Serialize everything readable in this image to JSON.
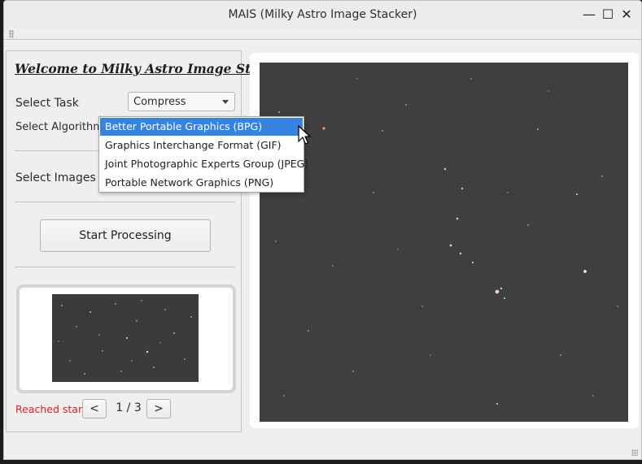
{
  "window": {
    "title": "MAIS (Milky Astro Image Stacker)",
    "minimize_glyph": "—",
    "maximize_glyph": "☐",
    "close_glyph": "✕"
  },
  "panel": {
    "welcome": "Welcome to Milky Astro Image Stacker",
    "task_label": "Select Task",
    "task_value": "Compress",
    "algorithm_label": "Select Algorithm",
    "images_label": "Select Images",
    "start_button": "Start Processing"
  },
  "algorithm_options": [
    "Better Portable Graphics (BPG)",
    "Graphics Interchange Format (GIF)",
    "Joint Photographic Experts Group (JPEG)",
    "Portable Network Graphics (PNG)"
  ],
  "navigation": {
    "status": "Reached start",
    "prev": "<",
    "next": ">",
    "page_current": "1",
    "page_total": "3"
  },
  "colors": {
    "selection": "#3584e4",
    "status_red": "#e01b1b",
    "sky": "#3f3f3f"
  },
  "icons": {
    "dropdown_arrow": "chevron-down-icon",
    "cursor": "mouse-pointer-icon"
  }
}
